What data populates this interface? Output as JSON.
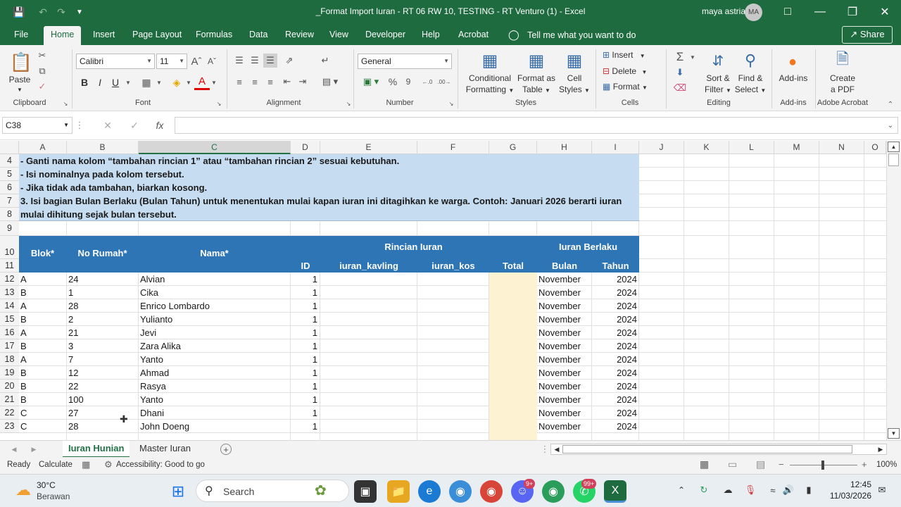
{
  "window": {
    "title": "_Format Import Iuran - RT 06 RW 10, TESTING - RT Venturo (1)  -  Excel",
    "user_name": "maya astria",
    "user_initials": "MA"
  },
  "menu": {
    "tabs": [
      "File",
      "Home",
      "Insert",
      "Page Layout",
      "Formulas",
      "Data",
      "Review",
      "View",
      "Developer",
      "Help",
      "Acrobat"
    ],
    "active": "Home",
    "tell_me": "Tell me what you want to do",
    "share": "Share"
  },
  "ribbon": {
    "clipboard": {
      "label": "Clipboard",
      "paste": "Paste"
    },
    "font": {
      "label": "Font",
      "font_name": "Calibri",
      "font_size": "11"
    },
    "alignment": {
      "label": "Alignment"
    },
    "number": {
      "label": "Number",
      "format": "General"
    },
    "styles": {
      "label": "Styles",
      "conditional": "Conditional",
      "conditional2": "Formatting",
      "format_as": "Format as",
      "format_as2": "Table",
      "cell": "Cell",
      "cell2": "Styles"
    },
    "cells": {
      "label": "Cells",
      "insert": "Insert",
      "delete": "Delete",
      "format": "Format"
    },
    "editing": {
      "label": "Editing",
      "sort": "Sort &",
      "sort2": "Filter",
      "find": "Find &",
      "find2": "Select"
    },
    "addins": {
      "label": "Add-ins",
      "button": "Add-ins"
    },
    "acrobat": {
      "label": "Adobe Acrobat",
      "create": "Create",
      "create2": "a PDF"
    }
  },
  "formula_bar": {
    "name_box": "C38",
    "formula": ""
  },
  "columns": [
    "A",
    "B",
    "C",
    "D",
    "E",
    "F",
    "G",
    "H",
    "I",
    "J",
    "K",
    "L",
    "M",
    "N",
    "O"
  ],
  "row_numbers": [
    "4",
    "5",
    "6",
    "7",
    "8",
    "9",
    "10",
    "11",
    "12",
    "13",
    "14",
    "15",
    "16",
    "17",
    "18",
    "19",
    "20",
    "21",
    "22",
    "23"
  ],
  "notes": [
    "  - Ganti nama kolom “tambahan rincian 1” atau “tambahan rincian 2” sesuai kebutuhan.",
    "  - Isi nominalnya pada kolom tersebut.",
    "  - Jika tidak ada tambahan, biarkan kosong.",
    "3. Isi bagian Bulan Berlaku (Bulan Tahun) untuk menentukan mulai kapan iuran ini ditagihkan ke warga. Contoh: Januari 2026 berarti iuran",
    "mulai dihitung sejak bulan tersebut."
  ],
  "table_header": {
    "blok": "Blok*",
    "no_rumah": "No Rumah*",
    "nama": "Nama*",
    "rincian": "Rincian Iuran",
    "iuran_berlaku": "Iuran Berlaku",
    "id": "ID",
    "iuran_kavling": "iuran_kavling",
    "iuran_kos": "iuran_kos",
    "total": "Total",
    "bulan": "Bulan",
    "tahun": "Tahun"
  },
  "rows": [
    {
      "blok": "A",
      "no": "24",
      "nama": "Alvian",
      "id": "1",
      "bulan": "November",
      "tahun": "2024"
    },
    {
      "blok": "B",
      "no": "1",
      "nama": "Cika",
      "id": "1",
      "bulan": "November",
      "tahun": "2024"
    },
    {
      "blok": "A",
      "no": "28",
      "nama": "Enrico Lombardo",
      "id": "1",
      "bulan": "November",
      "tahun": "2024"
    },
    {
      "blok": "B",
      "no": "2",
      "nama": "Yulianto",
      "id": "1",
      "bulan": "November",
      "tahun": "2024"
    },
    {
      "blok": "A",
      "no": "21",
      "nama": "Jevi",
      "id": "1",
      "bulan": "November",
      "tahun": "2024"
    },
    {
      "blok": "B",
      "no": "3",
      "nama": "Zara Alika",
      "id": "1",
      "bulan": "November",
      "tahun": "2024"
    },
    {
      "blok": "A",
      "no": "7",
      "nama": "Yanto",
      "id": "1",
      "bulan": "November",
      "tahun": "2024"
    },
    {
      "blok": "B",
      "no": "12",
      "nama": "Ahmad",
      "id": "1",
      "bulan": "November",
      "tahun": "2024"
    },
    {
      "blok": "B",
      "no": "22",
      "nama": "Rasya",
      "id": "1",
      "bulan": "November",
      "tahun": "2024"
    },
    {
      "blok": "B",
      "no": "100",
      "nama": "Yanto",
      "id": "1",
      "bulan": "November",
      "tahun": "2024"
    },
    {
      "blok": "C",
      "no": "27",
      "nama": "Dhani",
      "id": "1",
      "bulan": "November",
      "tahun": "2024"
    },
    {
      "blok": "C",
      "no": "28",
      "nama": "John Doeng",
      "id": "1",
      "bulan": "November",
      "tahun": "2024"
    }
  ],
  "sheet_tabs": [
    "Iuran Hunian",
    "Master Iuran"
  ],
  "active_sheet": "Iuran Hunian",
  "status": {
    "ready": "Ready",
    "calculate": "Calculate",
    "accessibility": "Accessibility: Good to go",
    "zoom": "100%"
  },
  "taskbar": {
    "weather_temp": "30°C",
    "weather_desc": "Berawan",
    "search": "Search",
    "badge_discord": "9+",
    "badge_whatsapp": "99+",
    "time": "12:45",
    "date": "11/03/2026"
  },
  "colors": {
    "excel_green": "#1e6b3f",
    "header_blue": "#2e75b6",
    "note_blue": "#c5dcf1",
    "total_yellow": "#fdf2d2"
  }
}
